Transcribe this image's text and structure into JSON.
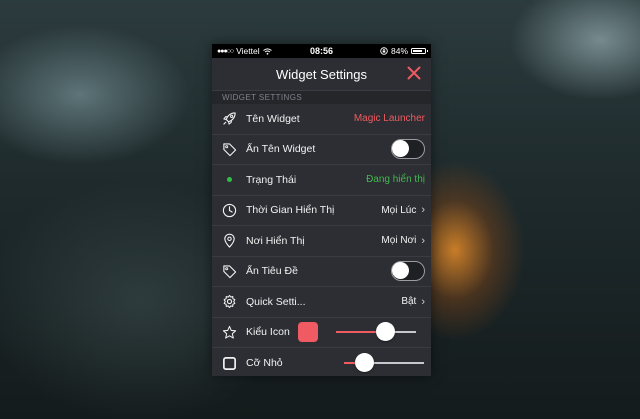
{
  "status_bar": {
    "carrier": "Viettel",
    "time": "08:56",
    "battery_percent": "84%",
    "battery_level": 0.84,
    "signal_icon": "signal-dots-icon",
    "wifi_icon": "wifi-icon",
    "lock_icon": "rotation-lock-icon"
  },
  "navbar": {
    "title": "Widget Settings",
    "close_icon": "close-icon",
    "close_color": "#ee5b60"
  },
  "section": {
    "header": "WIDGET SETTINGS"
  },
  "rows": {
    "widget_name": {
      "icon": "rocket-icon",
      "label": "Tên Widget",
      "value": "Magic Launcher",
      "value_color": "#ee5b60"
    },
    "hide_widget_name": {
      "icon": "tag-icon",
      "label": "Ẩn Tên Widget",
      "toggle_on": false
    },
    "status": {
      "icon": "green-dot-icon",
      "label": "Trạng Thái",
      "value": "Đang hiển thị",
      "value_color": "#3fb94d"
    },
    "display_time": {
      "icon": "clock-icon",
      "label": "Thời Gian Hiển Thị",
      "value": "Mọi Lúc"
    },
    "display_location": {
      "icon": "location-pin-icon",
      "label": "Nơi Hiển Thị",
      "value": "Mọi Nơi"
    },
    "hide_title": {
      "icon": "tag-icon",
      "label": "Ẩn Tiêu Đề",
      "toggle_on": false
    },
    "quick_settings": {
      "icon": "gear-icon",
      "label": "Quick Setti...",
      "value": "Bật"
    },
    "icon_style": {
      "icon": "star-icon",
      "label": "Kiểu Icon",
      "swatch_color": "#f05a63",
      "slider_value": 0.62
    },
    "small_size": {
      "icon": "square-icon",
      "label": "Cỡ Nhỏ",
      "slider_value": 0.25
    }
  }
}
